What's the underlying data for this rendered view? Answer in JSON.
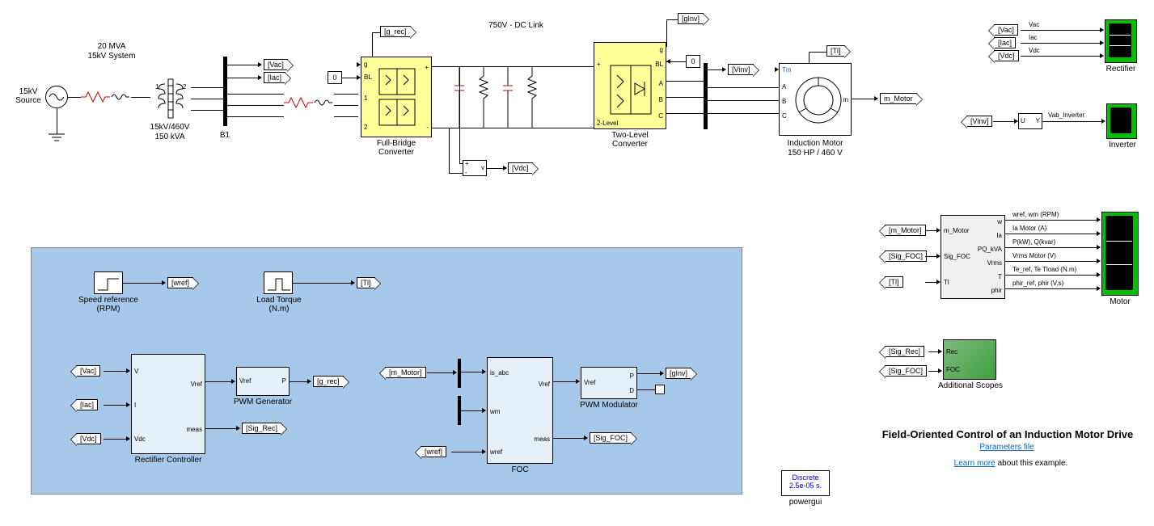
{
  "top": {
    "sourceName": "15kV\nSource",
    "mva": "20 MVA",
    "sys": "15kV System",
    "xfmrRatio": "15kV/460V",
    "xfmrKva": "150 kVA",
    "dcLink": "750V - DC Link",
    "fullBridge": "Full-Bridge\nConverter",
    "twoLevel": "Two-Level\nConverter",
    "motorName": "Induction Motor",
    "motorRating": "150 HP / 460 V",
    "B1": "B1",
    "tags": {
      "Vac": "[Vac]",
      "Iac": "[Iac]",
      "Vdc": "[Vdc]",
      "g_rec": "[g_rec]",
      "gInv": "[gInv]",
      "Tl": "[Tl]",
      "Vinv": "[Vinv]",
      "m_Motor": "m_Motor"
    },
    "const0": "0",
    "ports": {
      "g": "g",
      "BL": "BL",
      "one": "1",
      "two": "2",
      "plus": "+",
      "minus": "-",
      "A": "A",
      "B": "B",
      "C": "C",
      "twoLevel": "2-Level",
      "v": "v",
      "Tm": "Tm",
      "m": "m"
    }
  },
  "right": {
    "rectifierScope": "Rectifier",
    "rectifierSignals": {
      "Vac": "Vac",
      "Iac": "Iac",
      "Vdc": "Vdc"
    },
    "inverterScope": "Inverter",
    "inverterBlk": {
      "U": "U",
      "Y": "Y",
      "label": "Vab_Inverter"
    },
    "motorScope": {
      "name": "Motor",
      "sigs": [
        "wref, wm (RPM)",
        "Ia Motor (A)",
        "P(kW), Q(kvar)",
        "Vrms Motor (V)",
        "Te_ref, Te  Tload (N.m)",
        "phir_ref, phir (V.s)"
      ],
      "inPorts": {
        "m_Motor": "m_Motor",
        "Sig_FOC": "Sig_FOC",
        "Tl": "Tl"
      },
      "outPorts": {
        "w": "w",
        "Ia": "Ia",
        "PQ_kVA": "PQ_kVA",
        "Vrms": "Vrms",
        "T": "T",
        "phir": "phir"
      },
      "tags": {
        "m_Motor": "[m_Motor]",
        "Sig_FOC": "[Sig_FOC]",
        "Tl": "[Tl]"
      }
    },
    "addScopes": {
      "name": "Additional Scopes",
      "Rec": "Rec",
      "FOC": "FOC",
      "tags": {
        "Sig_Rec": "[Sig_Rec]",
        "Sig_FOC": "[Sig_FOC]"
      }
    },
    "title": "Field-Oriented Control of an Induction Motor Drive",
    "paramsLink": "Parameters file",
    "learnMore1": "Learn more",
    "learnMore2": " about this example."
  },
  "control": {
    "speedRef": {
      "name": "Speed reference\n(RPM)",
      "tag": "[wref]"
    },
    "loadTq": {
      "name": "Load Torque\n(N.m)",
      "tag": "[Tl]"
    },
    "rectCtrl": {
      "name": "Rectifier Controller",
      "V": "V",
      "I": "I",
      "Vdc": "Vdc",
      "Vref": "Vref",
      "meas": "meas",
      "tagsIn": {
        "Vac": "[Vac]",
        "Iac": "[Iac]",
        "Vdc": "[Vdc]"
      }
    },
    "pwmGen": {
      "name": "PWM Generator",
      "Vref": "Vref",
      "P": "P",
      "out": "[g_rec]"
    },
    "foc": {
      "name": "FOC",
      "is_abc": "is_abc",
      "wm": "wm",
      "wref": "wref",
      "Vref": "Vref",
      "meas": "meas",
      "tagsIn": {
        "m_Motor": "[m_Motor]",
        "wref": "[wref]"
      }
    },
    "pwmMod": {
      "name": "PWM Modulator",
      "Vref": "Vref",
      "P": "P",
      "D": "D",
      "out": "[gInv]"
    },
    "sigRec": "[Sig_Rec]",
    "sigFOC": "[Sig_FOC]"
  },
  "powergui": {
    "l1": "Discrete",
    "l2": "2.5e-05 s.",
    "name": "powergui"
  },
  "tags": {
    "Vinv": "[Vinv]"
  },
  "chart_data": {
    "type": "diagram",
    "description": "Simulink block diagram: Field-Oriented Control of an Induction Motor Drive",
    "power_chain": [
      {
        "block": "15kV Source",
        "type": "three-phase source"
      },
      {
        "block": "Series RL",
        "note": "line impedance"
      },
      {
        "block": "Transformer",
        "rating": "15kV/460V 150 kVA"
      },
      {
        "block": "B1",
        "type": "Bus/Measurement"
      },
      {
        "block": "Full-Bridge Converter",
        "gates_from": "g_rec"
      },
      {
        "block": "DC Link",
        "voltage_label": "750V - DC Link",
        "elements": [
          "capacitor",
          "braking resistor",
          "capacitor",
          "resistor"
        ]
      },
      {
        "block": "Two-Level Converter",
        "gates_from": "gInv",
        "outputs": [
          "A",
          "B",
          "C"
        ]
      },
      {
        "block": "Bus",
        "name": "Vinv measurement"
      },
      {
        "block": "Induction Motor",
        "rating": "150 HP / 460 V",
        "inputs": [
          "Tm",
          "A",
          "B",
          "C"
        ],
        "outputs": [
          "m"
        ]
      }
    ],
    "measurements": [
      "Vac",
      "Iac",
      "Vdc",
      "Vinv",
      "m_Motor"
    ],
    "controllers": [
      {
        "block": "Rectifier Controller",
        "in": [
          "V",
          "I",
          "Vdc"
        ],
        "out": [
          "Vref",
          "meas"
        ]
      },
      {
        "block": "PWM Generator",
        "in": [
          "Vref"
        ],
        "out": [
          "P -> g_rec"
        ]
      },
      {
        "block": "FOC",
        "in": [
          "is_abc",
          "wm",
          "wref"
        ],
        "out": [
          "Vref",
          "meas"
        ]
      },
      {
        "block": "PWM Modulator",
        "in": [
          "Vref"
        ],
        "out": [
          "P -> gInv",
          "D"
        ]
      }
    ],
    "reference_inputs": [
      {
        "name": "Speed reference (RPM)",
        "tag": "wref"
      },
      {
        "name": "Load Torque (N.m)",
        "tag": "Tl"
      }
    ],
    "scopes": [
      {
        "name": "Rectifier",
        "signals": [
          "Vac",
          "Iac",
          "Vdc"
        ]
      },
      {
        "name": "Inverter",
        "signals": [
          "Vab_Inverter"
        ]
      },
      {
        "name": "Motor",
        "signals": [
          "wref, wm (RPM)",
          "Ia Motor (A)",
          "P(kW), Q(kvar)",
          "Vrms Motor (V)",
          "Te_ref, Te Tload (N.m)",
          "phir_ref, phir (V.s)"
        ]
      },
      {
        "name": "Additional Scopes",
        "signals": [
          "Rec",
          "FOC"
        ]
      }
    ],
    "solver": {
      "type": "Discrete",
      "step": "2.5e-05 s"
    }
  }
}
